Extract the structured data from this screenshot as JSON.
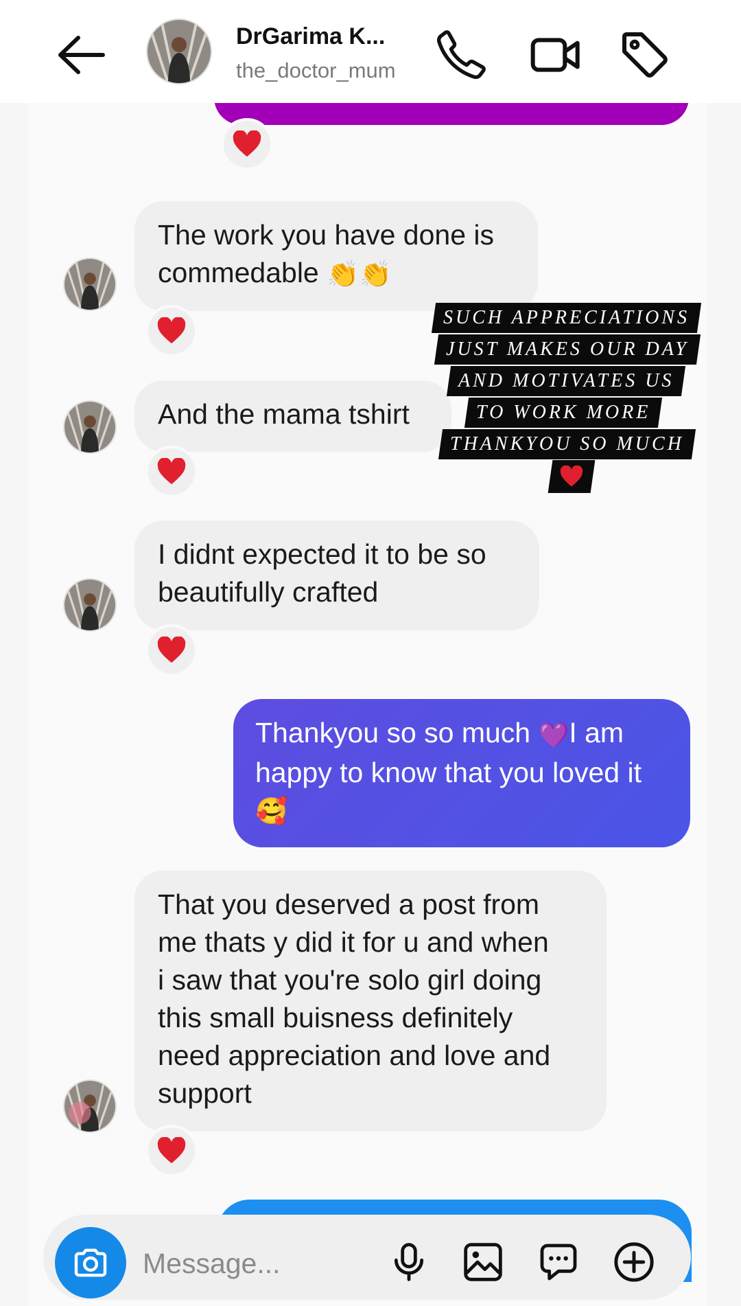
{
  "header": {
    "name": "DrGarima K...",
    "username": "the_doctor_mum"
  },
  "messages": [
    {
      "from": "them",
      "text": "The work you have done is\ncommedable",
      "emoji": "👏👏",
      "reaction": "❤️"
    },
    {
      "from": "them",
      "text": "And the mama tshirt",
      "reaction": "❤️"
    },
    {
      "from": "them",
      "text": "I didnt expected it to be so\nbeautifully crafted",
      "reaction": "❤️"
    },
    {
      "from": "me",
      "text_before": "Thankyou so so much ",
      "emoji_mid": "💜",
      "text_after": "I am\nhappy to know that you loved it",
      "emoji_end": "🥰"
    },
    {
      "from": "them",
      "text": "That you deserved a post from\nme thats y did it for u and when\ni saw that you're solo girl doing\nthis small buisness definitely\nneed appreciation and love and\nsupport",
      "reaction": "❤️"
    }
  ],
  "top_reaction": "❤️",
  "overlay": {
    "lines": [
      "SUCH APPRECIATIONS",
      "JUST MAKES OUR DAY",
      "AND MOTIVATES US",
      "TO WORK MORE",
      "THANKYOU SO MUCH"
    ],
    "heart": "❤️"
  },
  "composer": {
    "placeholder": "Message..."
  },
  "icons": {
    "back": "arrow-left-icon",
    "call": "phone-icon",
    "video": "video-camera-icon",
    "tag": "tag-icon",
    "camera": "camera-icon",
    "mic": "microphone-icon",
    "gallery": "image-icon",
    "sticker": "chat-sticker-icon",
    "more": "plus-circle-icon"
  },
  "colors": {
    "sent_bubble": "#5151e2",
    "received_bubble": "#efefef",
    "camera_button": "#1589e8",
    "purple_strip": "#a100b8",
    "heart": "#e0202e"
  }
}
